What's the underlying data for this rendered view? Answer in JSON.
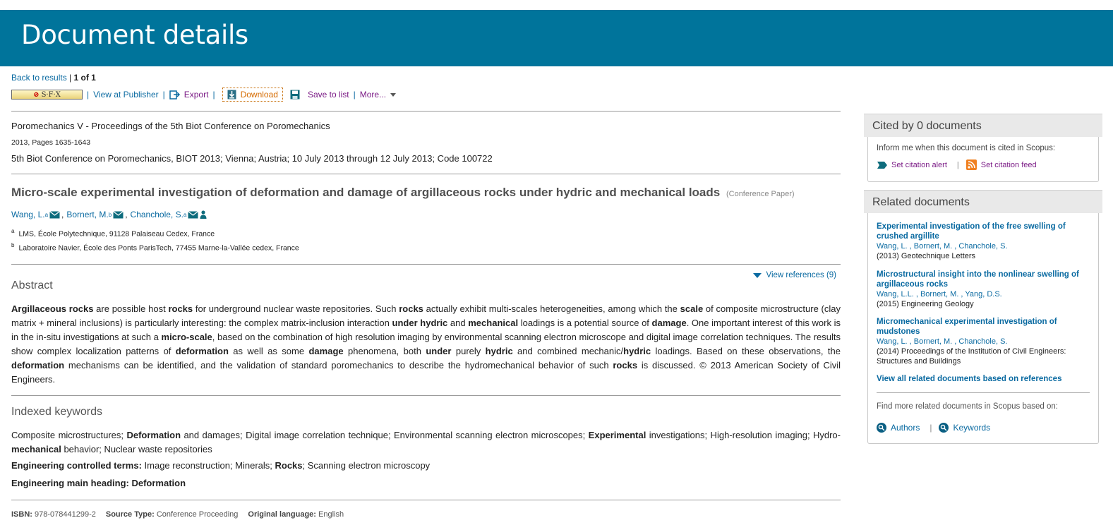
{
  "header": {
    "title": "Document details"
  },
  "nav": {
    "back_label": "Back to results",
    "divider": "|",
    "position": "1 of 1"
  },
  "toolbar": {
    "sfx_label": "S·F·X",
    "view_publisher": "View at Publisher",
    "export": "Export",
    "download": "Download",
    "save_to_list": "Save to list",
    "more": "More..."
  },
  "source": {
    "title": "Poromechanics V - Proceedings of the 5th Biot Conference on Poromechanics",
    "year_pages": "2013, Pages 1635-1643",
    "conference": "5th Biot Conference on Poromechanics, BIOT 2013; Vienna; Austria; 10 July 2013 through 12 July 2013; Code 100722"
  },
  "document": {
    "title": "Micro-scale experimental investigation of deformation and damage of argillaceous rocks under hydric and mechanical loads",
    "type": "(Conference Paper)"
  },
  "authors": [
    {
      "name": "Wang, L.",
      "sup": "a"
    },
    {
      "name": "Bornert, M.",
      "sup": "b"
    },
    {
      "name": "Chanchole, S.",
      "sup": "a"
    }
  ],
  "affiliations": [
    {
      "sup": "a",
      "text": "LMS, École Polytechnique, 91128 Palaiseau Cedex, France"
    },
    {
      "sup": "b",
      "text": "Laboratoire Navier, École des Ponts ParisTech, 77455 Marne-la-Vallée cedex, France"
    }
  ],
  "view_references": "View references (9)",
  "abstract": {
    "heading": "Abstract",
    "segments": [
      [
        "Argillaceous rocks",
        true
      ],
      [
        " are possible host ",
        false
      ],
      [
        "rocks",
        true
      ],
      [
        " for underground nuclear waste repositories. Such ",
        false
      ],
      [
        "rocks",
        true
      ],
      [
        " actually exhibit multi-scales heterogeneities, among which the ",
        false
      ],
      [
        "scale",
        true
      ],
      [
        " of composite microstructure (clay matrix + mineral inclusions) is particularly interesting: the complex matrix-inclusion interaction ",
        false
      ],
      [
        "under hydric",
        true
      ],
      [
        " and ",
        false
      ],
      [
        "mechanical",
        true
      ],
      [
        " loadings is a potential source of ",
        false
      ],
      [
        "damage",
        true
      ],
      [
        ". One important interest of this work is in the in-situ investigations at such a ",
        false
      ],
      [
        "micro-scale",
        true
      ],
      [
        ", based on the combination of high resolution imaging by environmental scanning electron microscope and digital image correlation techniques. The results show complex localization patterns of ",
        false
      ],
      [
        "deformation",
        true
      ],
      [
        " as well as some ",
        false
      ],
      [
        "damage",
        true
      ],
      [
        " phenomena, both ",
        false
      ],
      [
        "under",
        true
      ],
      [
        " purely ",
        false
      ],
      [
        "hydric",
        true
      ],
      [
        " and combined mechanic/",
        false
      ],
      [
        "hydric",
        true
      ],
      [
        " loadings. Based on these observations, the ",
        false
      ],
      [
        "deformation",
        true
      ],
      [
        " mechanisms can be identified, and the validation of standard poromechanics to describe the hydromechanical behavior of such ",
        false
      ],
      [
        "rocks",
        true
      ],
      [
        " is discussed. © 2013 American Society of Civil Engineers.",
        false
      ]
    ]
  },
  "keywords": {
    "heading": "Indexed keywords",
    "line1_segments": [
      [
        "Composite microstructures; ",
        false
      ],
      [
        "Deformation",
        true
      ],
      [
        " and damages; Digital image correlation technique; Environmental scanning electron microscopes; ",
        false
      ],
      [
        "Experimental",
        true
      ],
      [
        " investigations; High-resolution imaging; Hydro-",
        false
      ],
      [
        "mechanical",
        true
      ],
      [
        " behavior; Nuclear waste repositories",
        false
      ]
    ],
    "controlled_label": "Engineering controlled terms:",
    "controlled_segments": [
      [
        " Image reconstruction; Minerals; ",
        false
      ],
      [
        "Rocks",
        true
      ],
      [
        "; Scanning electron microscopy",
        false
      ]
    ],
    "main_heading_label": "Engineering main heading:",
    "main_heading_value": "Deformation"
  },
  "meta": {
    "isbn_label": "ISBN:",
    "isbn": "978-078441299-2",
    "source_type_label": "Source Type:",
    "source_type": "Conference Proceeding",
    "language_label": "Original language:",
    "language": "English"
  },
  "cited_by": {
    "heading": "Cited by 0 documents",
    "inform": "Inform me when this document is cited in Scopus:",
    "alert": "Set citation alert",
    "feed": "Set citation feed"
  },
  "related": {
    "heading": "Related documents",
    "items": [
      {
        "title": "Experimental investigation of the free swelling of crushed argillite",
        "authors": [
          "Wang, L.",
          "Bornert, M.",
          "Chanchole, S."
        ],
        "source": "(2013) Geotechnique Letters"
      },
      {
        "title": "Microstructural insight into the nonlinear swelling of argillaceous rocks",
        "authors": [
          "Wang, L.L.",
          "Bornert, M.",
          "Yang, D.S."
        ],
        "source": "(2015) Engineering Geology"
      },
      {
        "title": "Micromechanical experimental investigation of mudstones",
        "authors": [
          "Wang, L.",
          "Bornert, M.",
          "Chanchole, S."
        ],
        "source": "(2014) Proceedings of the Institution of Civil Engineers: Structures and Buildings"
      }
    ],
    "view_all": "View all related documents based on references",
    "find_more": "Find more related documents in Scopus based on:",
    "authors_link": "Authors",
    "keywords_link": "Keywords"
  },
  "colors": {
    "banner": "#00749b",
    "link": "#0a6aa1",
    "purple": "#7b1b86",
    "download": "#d56b00"
  }
}
